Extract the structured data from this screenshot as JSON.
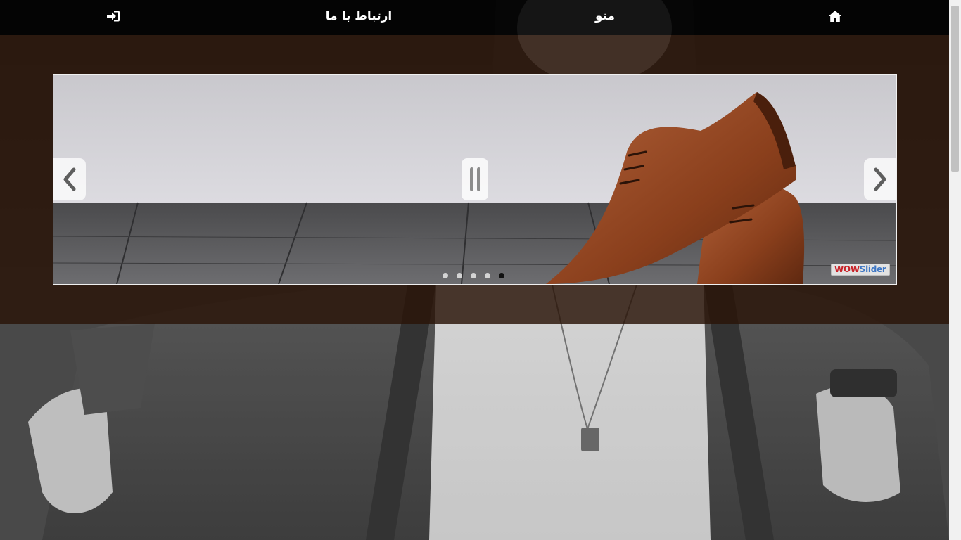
{
  "navbar": {
    "home_icon": "home-icon",
    "menu_label": "منو",
    "contact_label": "ارتباط با ما",
    "login_icon": "sign-in-icon"
  },
  "slider": {
    "slide_count": 5,
    "active_slide": 5,
    "prev_icon": "chevron-left-icon",
    "next_icon": "chevron-right-icon",
    "pause_icon": "pause-icon",
    "badge_part1": "WOW",
    "badge_part2": "Slider"
  },
  "colors": {
    "navbar_bg": "#000000",
    "band_brown": "#2b160a",
    "nav_text": "#ffffff",
    "shoe_brown": "#8a3f1c"
  }
}
